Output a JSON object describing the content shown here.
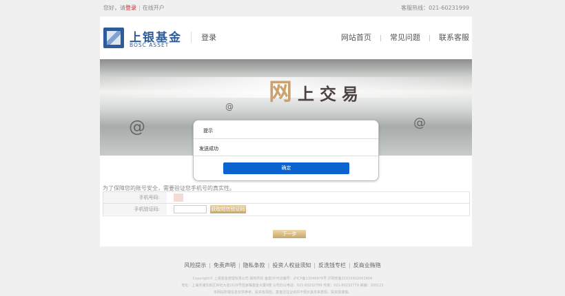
{
  "topbar": {
    "greeting": "您好，请",
    "login": "登录",
    "separator": "|",
    "open_account": "在线开户",
    "hotline": "客服热线：021-60231999"
  },
  "header": {
    "logo_cn": "上银基金",
    "logo_en": "BOSC ASSET",
    "page_title": "登录",
    "nav": [
      "网站首页",
      "常见问题",
      "联系客服"
    ],
    "nav_divider": "|"
  },
  "banner": {
    "text_big": "网",
    "text_rest": "上交易",
    "at_symbol": "@"
  },
  "form": {
    "notice": "为了保障您的账号安全，需要验证您手机号的真实性。",
    "phone_label": "手机号码:",
    "code_label": "手机验证码:",
    "get_code_button": "获取短信验证码",
    "next_button": "下一步"
  },
  "dialog": {
    "title": "提示",
    "message": "发送成功",
    "ok": "确定"
  },
  "footer": {
    "links": [
      "风险提示",
      "免责声明",
      "隐私条款",
      "投资人权益须知",
      "反洗钱专栏",
      "反商业贿赂"
    ],
    "link_sep": "|",
    "copyright": "Copyright© 上银基金管理有限公司 版权所有 备案/许可证编号：沪ICP备13046979号 沪网安备31010902001904",
    "address": "地址：上海市浦东新区世纪大道1528号陆家嘴基金大厦9楼 公司办公电话：021-60232799 传真：021-60232779 邮编：200122",
    "risk": "本网站所载信息仅供参考，投资有风险，基金过往业绩并不预示其未来表现，投资需谨慎。"
  }
}
